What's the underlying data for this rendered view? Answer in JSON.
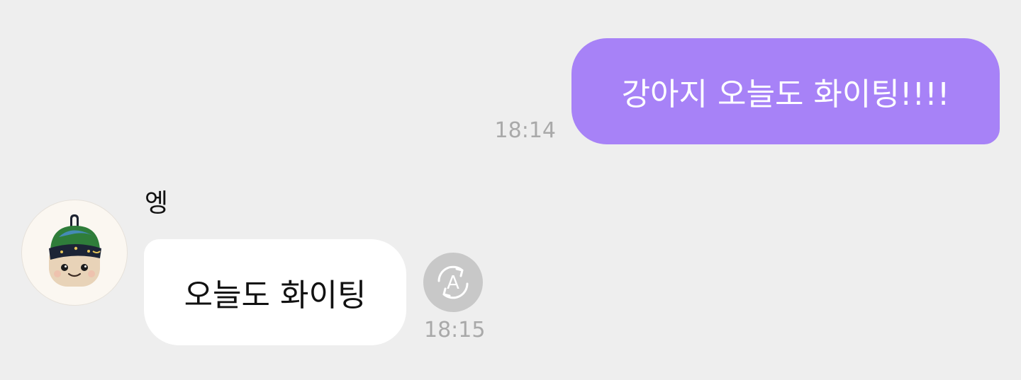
{
  "messages": {
    "outgoing": {
      "text": "강아지 오늘도 화이팅!!!!",
      "time": "18:14"
    },
    "incoming": {
      "sender_name": "엥",
      "text": "오늘도 화이팅",
      "time": "18:15",
      "avatar_icon": "plush-toy-avatar",
      "translate_icon": "translate-icon",
      "translate_letter": "A"
    }
  },
  "colors": {
    "background": "#eeeeee",
    "outgoing_bubble": "#a782f7",
    "incoming_bubble": "#ffffff",
    "timestamp": "#a9a9a9",
    "translate_button": "#c8c8c8"
  }
}
